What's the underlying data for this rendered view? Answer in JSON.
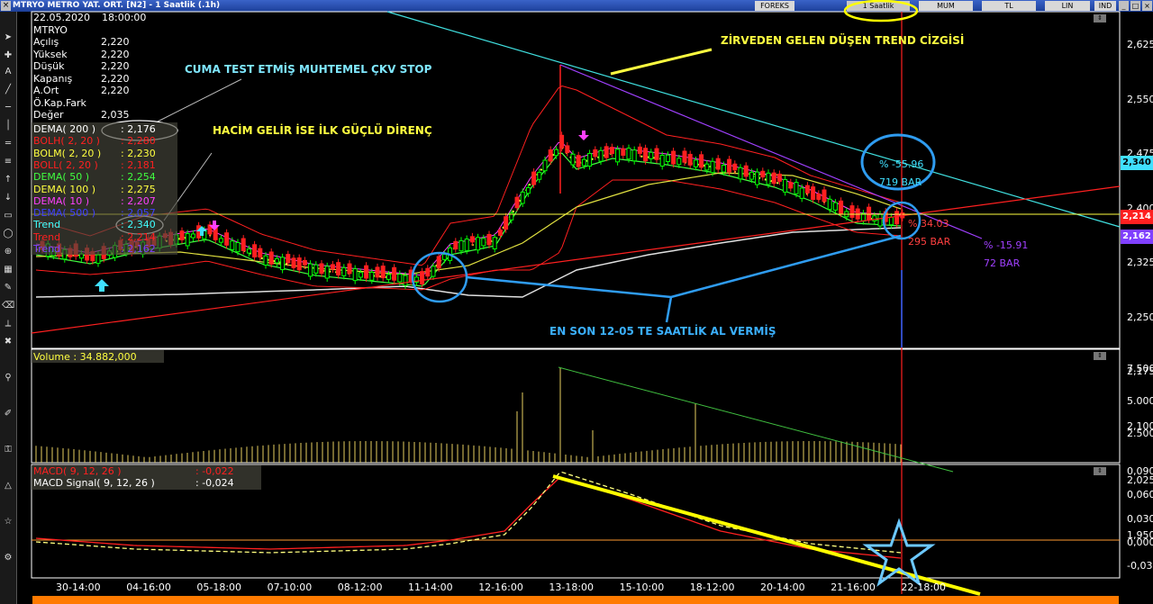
{
  "window": {
    "title": "MTRYO METRO YAT. ORT. [N2] - 1 Saatlik (.1h)",
    "close": "×"
  },
  "titlebar_tabs": [
    "FOREKS",
    "1 Saatlik",
    "MUM",
    "TL",
    "LIN",
    "IND"
  ],
  "window_buttons": [
    "_",
    "□",
    "×"
  ],
  "info": {
    "date": "22.05.2020",
    "time": "18:00:00",
    "symbol": "MTRYO",
    "rows": [
      {
        "label": "Açılış",
        "value": "2,220"
      },
      {
        "label": "Yüksek",
        "value": "2,220"
      },
      {
        "label": "Düşük",
        "value": "2,220"
      },
      {
        "label": "Kapanış",
        "value": "2,220"
      },
      {
        "label": "A.Ort",
        "value": "2,220"
      },
      {
        "label": "Ö.Kap.Fark",
        "value": ""
      },
      {
        "label": "Değer",
        "value": "2,035"
      }
    ]
  },
  "indicators": [
    {
      "label": "DEMA( 200 )",
      "value": ": 2,176",
      "color": "#ffffff"
    },
    {
      "label": "BOLH( 2, 20 )",
      "value": ": 2,280",
      "color": "#ff2020"
    },
    {
      "label": "BOLM( 2, 20 )",
      "value": ": 2,230",
      "color": "#ffff40"
    },
    {
      "label": "BOLL( 2, 20 )",
      "value": ": 2,181",
      "color": "#ff2020"
    },
    {
      "label": "DEMA( 50 )",
      "value": ": 2,254",
      "color": "#40ff40"
    },
    {
      "label": "DEMA( 100 )",
      "value": ": 2,275",
      "color": "#ffff40"
    },
    {
      "label": "DEMA( 10 )",
      "value": ": 2,207",
      "color": "#ff40ff"
    },
    {
      "label": "DEMA( 500 )",
      "value": ": 2,057",
      "color": "#4040ff"
    },
    {
      "label": "Trend",
      "value": ": 2,340",
      "color": "#40ffff"
    },
    {
      "label": "Trend",
      "value": ": 2,214",
      "color": "#ff2020"
    },
    {
      "label": "Trend",
      "value": ": 2,162",
      "color": "#8040ff"
    }
  ],
  "annotations": {
    "cuma": "CUMA TEST ETMİŞ MUHTEMEL ÇKV STOP",
    "hacim": "HACİM GELİR İSE İLK GÜÇLÜ DİRENÇ",
    "zirve": "ZİRVEDEN GELEN DÜŞEN TREND CİZGİSİ",
    "ensom": "EN SON 12-05 TE SAATLİK AL VERMİŞ"
  },
  "trend_labels": {
    "cyan_pct": "% -55.96",
    "cyan_bar": "719 BAR",
    "red_pct": "% 34.03",
    "red_bar": "295 BAR",
    "purple_pct": "% -15.91",
    "purple_bar": "72 BAR"
  },
  "price_axis": [
    "2,625",
    "2,550",
    "2,475",
    "2,400",
    "2,325",
    "2,250",
    "2,175",
    "2,100",
    "2,025",
    "1,950"
  ],
  "price_tags": [
    {
      "value": "2,340",
      "bg": "#40e0ff",
      "fg": "#000000"
    },
    {
      "value": "2,214",
      "bg": "#ff2020",
      "fg": "#ffffff"
    },
    {
      "value": "2,162",
      "bg": "#8040ff",
      "fg": "#ffffff"
    }
  ],
  "volume": {
    "label": "Volume : 34.882,000",
    "axis": [
      "7.500",
      "5.000",
      "2.500"
    ]
  },
  "macd": {
    "macd_label": "MACD( 9, 12, 26 )",
    "macd_value": ": -0,022",
    "signal_label": "MACD Signal( 9, 12, 26 )",
    "signal_value": ": -0,024",
    "axis": [
      "0,090",
      "0,060",
      "0,030",
      "0,000",
      "-0,030"
    ]
  },
  "time_axis": [
    "30-14:00",
    "04-16:00",
    "05-18:00",
    "07-10:00",
    "08-12:00",
    "11-14:00",
    "12-16:00",
    "13-18:00",
    "15-10:00",
    "18-12:00",
    "20-14:00",
    "21-16:00",
    "22-18:00"
  ],
  "colors": {
    "bull": "#00ff00",
    "bear": "#ff2020",
    "annotation": "#ffff00"
  }
}
